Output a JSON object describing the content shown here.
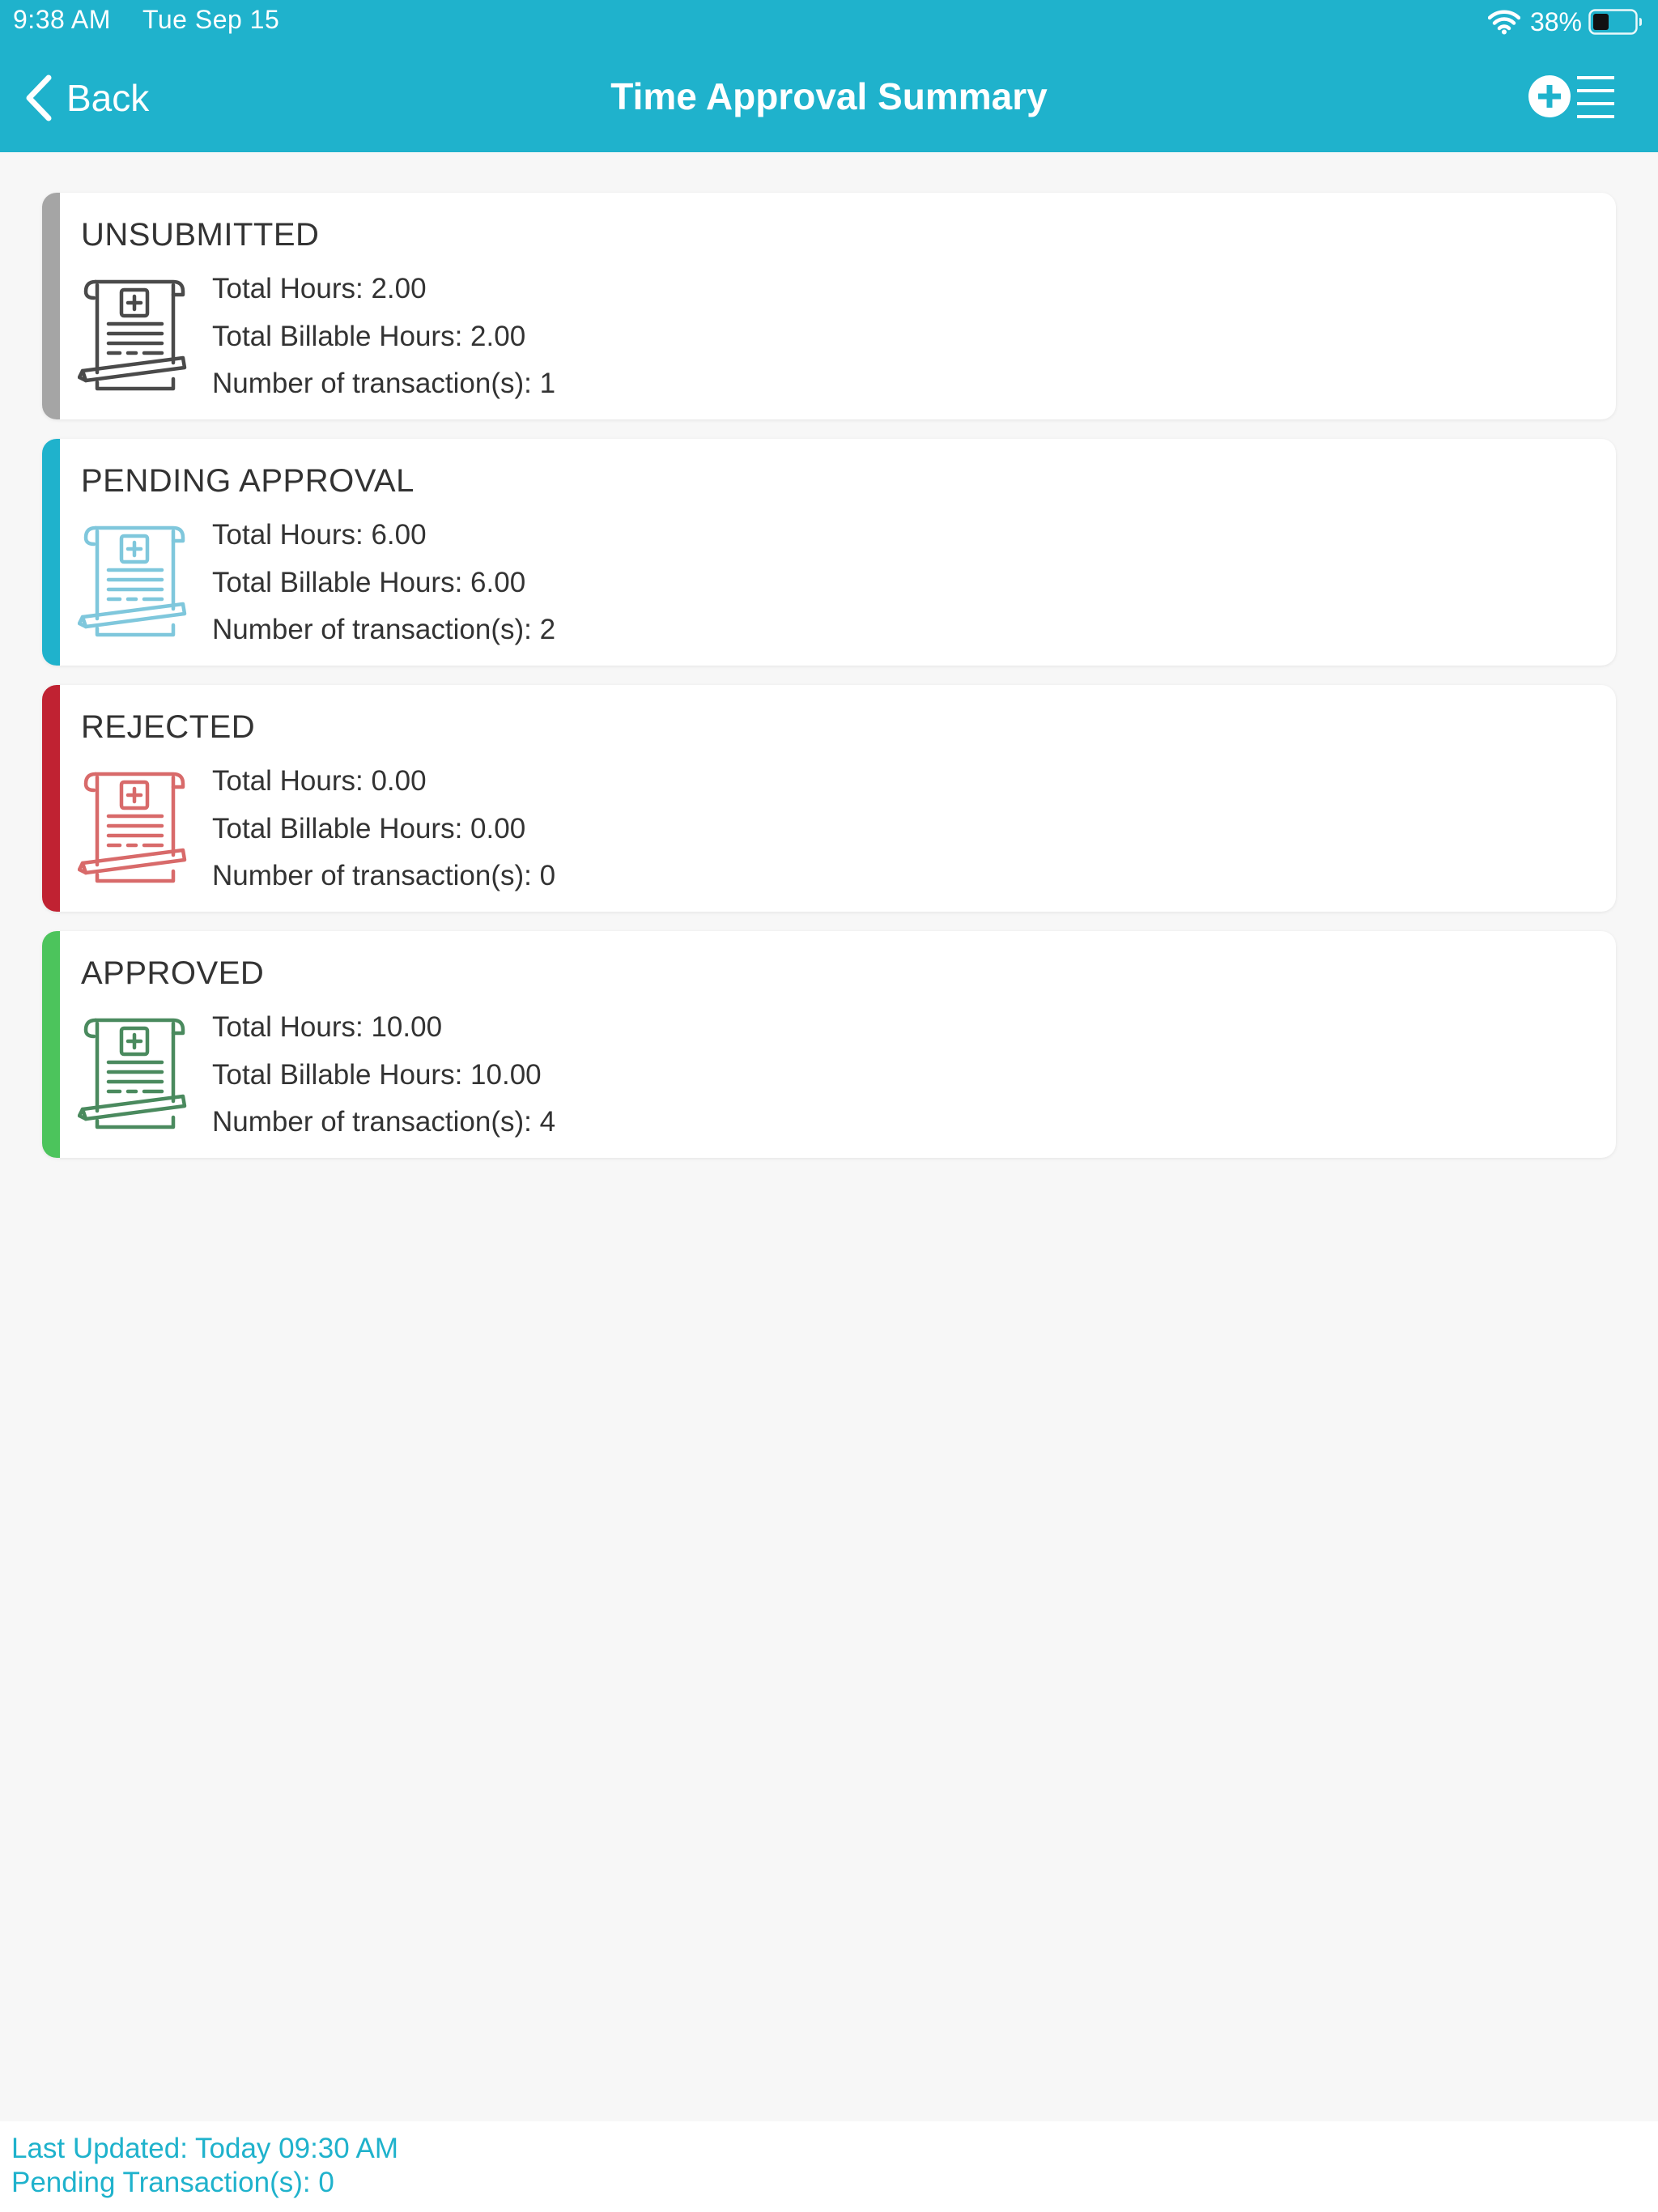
{
  "status_bar": {
    "time": "9:38 AM",
    "date": "Tue Sep 15",
    "battery": "38%"
  },
  "nav": {
    "back_label": "Back",
    "title": "Time Approval Summary",
    "add_menu_icon": "add-list-icon"
  },
  "cards": [
    {
      "title": "UNSUBMITTED",
      "color": "#a5a5a5",
      "icon_color": "#4a4a4a",
      "lines": [
        "Total Hours:  2.00",
        "Total Billable Hours:  2.00",
        "Number of transaction(s):  1"
      ]
    },
    {
      "title": "PENDING APPROVAL",
      "color": "#1fb2cc",
      "icon_color": "#7fc7dc",
      "lines": [
        "Total Hours:  6.00",
        "Total Billable Hours:  6.00",
        "Number of transaction(s):  2"
      ]
    },
    {
      "title": "REJECTED",
      "color": "#c02232",
      "icon_color": "#d86a6a",
      "lines": [
        "Total Hours:  0.00",
        "Total Billable Hours:  0.00",
        "Number of transaction(s):  0"
      ]
    },
    {
      "title": "APPROVED",
      "color": "#4cc45c",
      "icon_color": "#4a8a5e",
      "lines": [
        "Total Hours:  10.00",
        "Total Billable Hours:  10.00",
        "Number of transaction(s):  4"
      ]
    }
  ],
  "footer": {
    "last_updated": "Last Updated: Today 09:30 AM",
    "pending": "Pending Transaction(s): 0"
  }
}
